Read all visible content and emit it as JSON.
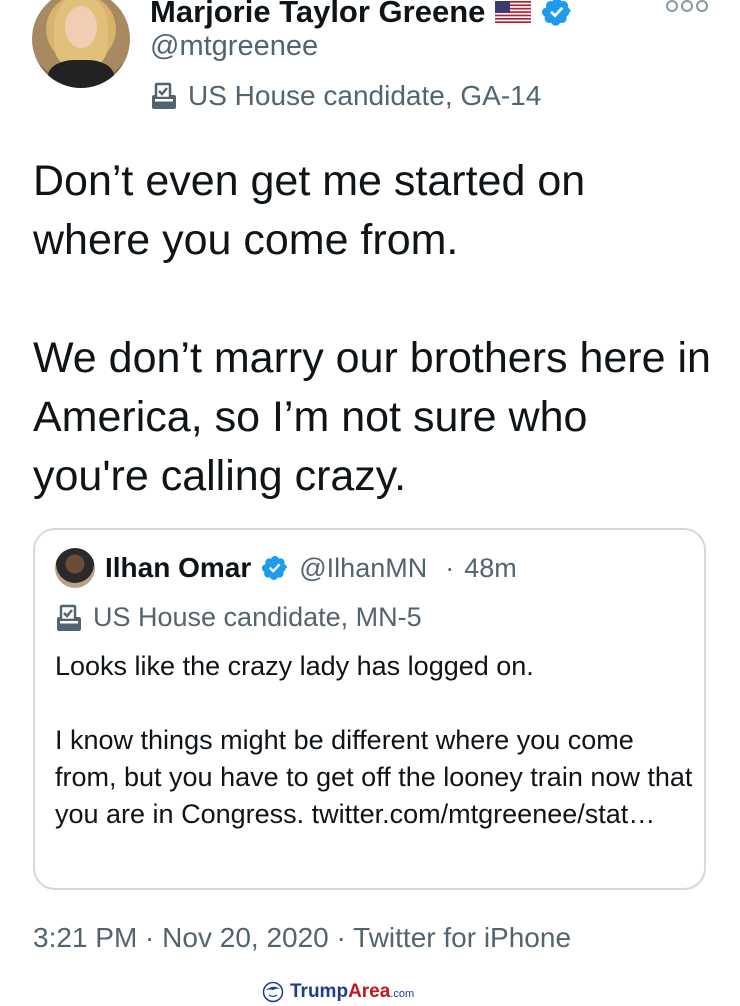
{
  "author": {
    "display_name": "Marjorie Taylor Greene",
    "handle": "@mtgreenee",
    "label": "US House candidate, GA-14",
    "avatar_icon": "profile-photo",
    "flag_icon": "us-flag-icon",
    "verified_icon": "verified-badge-icon"
  },
  "menu": {
    "icon": "more-options-icon"
  },
  "tweet": {
    "paragraphs": [
      "Don’t even get me started on where you come from.",
      "We don’t marry our brothers here in America, so I’m not sure who you're calling crazy."
    ]
  },
  "quote": {
    "display_name": "Ilhan Omar",
    "handle": "@IlhanMN",
    "separator": "·",
    "time": "48m",
    "label": "US House candidate, MN-5",
    "paragraphs": [
      "Looks like the crazy lady has logged on.",
      "I know things might be different where you come from, but you have to get off the looney train now that you are in Congress. twitter.com/mtgreenee/stat…"
    ]
  },
  "meta": {
    "time": "3:21 PM",
    "sep1": " · ",
    "date": "Nov 20, 2020",
    "sep2": " · ",
    "source": "Twitter for iPhone"
  },
  "watermark": {
    "brand_a": "Trump",
    "brand_b": "Area",
    "suffix": ".com"
  },
  "colors": {
    "verified_blue": "#1d9bf0",
    "secondary_text": "#536471",
    "border": "#cfd9de"
  }
}
